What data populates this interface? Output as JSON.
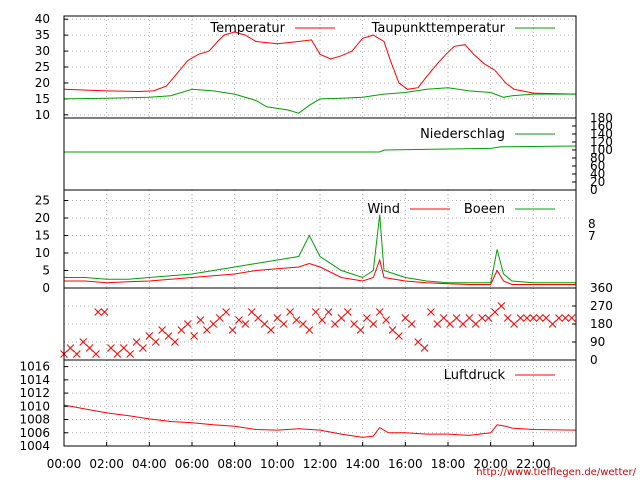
{
  "chart_data": {
    "type": "line",
    "x_tick_labels": [
      "00:00",
      "02:00",
      "04:00",
      "06:00",
      "08:00",
      "10:00",
      "12:00",
      "14:00",
      "16:00",
      "18:00",
      "20:00",
      "22:00"
    ],
    "x_range_hours": [
      0,
      24
    ],
    "credit": "http://www.tiefflegen.de/wetter/",
    "colors": {
      "red": "#ff0000",
      "green": "#00a000"
    },
    "panels": [
      {
        "id": "temperature",
        "ylim": [
          9,
          41
        ],
        "y_ticks": [
          "10",
          "15",
          "20",
          "25",
          "30",
          "35",
          "40"
        ],
        "grid": true,
        "series": [
          {
            "name": "Temperatur",
            "color": "#ff0000",
            "points": [
              [
                0,
                18
              ],
              [
                2,
                17.5
              ],
              [
                3.5,
                17.3
              ],
              [
                4.2,
                17.5
              ],
              [
                4.8,
                19
              ],
              [
                5.3,
                23
              ],
              [
                5.8,
                27
              ],
              [
                6.3,
                29
              ],
              [
                6.8,
                30
              ],
              [
                7.2,
                33
              ],
              [
                7.5,
                35
              ],
              [
                8,
                36
              ],
              [
                8.5,
                35
              ],
              [
                9,
                33
              ],
              [
                10,
                32.3
              ],
              [
                11,
                33
              ],
              [
                11.6,
                33.5
              ],
              [
                12,
                29
              ],
              [
                12.5,
                27.5
              ],
              [
                13,
                28.5
              ],
              [
                13.5,
                30
              ],
              [
                14,
                34
              ],
              [
                14.5,
                35
              ],
              [
                15,
                33
              ],
              [
                15.3,
                27
              ],
              [
                15.7,
                20
              ],
              [
                16.1,
                18
              ],
              [
                16.6,
                18.5
              ],
              [
                17,
                22
              ],
              [
                17.5,
                26
              ],
              [
                17.9,
                29
              ],
              [
                18.3,
                31.5
              ],
              [
                18.8,
                32
              ],
              [
                19.2,
                29
              ],
              [
                19.7,
                26
              ],
              [
                20.2,
                24
              ],
              [
                20.7,
                20
              ],
              [
                21.1,
                18
              ],
              [
                22,
                16.8
              ],
              [
                24,
                16.5
              ]
            ]
          },
          {
            "name": "Taupunkttemperatur",
            "color": "#00a000",
            "points": [
              [
                0,
                15
              ],
              [
                2,
                15.2
              ],
              [
                4,
                15.5
              ],
              [
                5,
                16
              ],
              [
                6,
                18
              ],
              [
                7,
                17.5
              ],
              [
                8,
                16.5
              ],
              [
                9,
                14.5
              ],
              [
                9.5,
                12.5
              ],
              [
                10,
                12
              ],
              [
                10.5,
                11.5
              ],
              [
                11,
                10.5
              ],
              [
                11.5,
                13
              ],
              [
                12,
                15
              ],
              [
                13,
                15.2
              ],
              [
                14,
                15.5
              ],
              [
                15,
                16.5
              ],
              [
                16,
                17
              ],
              [
                17,
                18
              ],
              [
                18,
                18.5
              ],
              [
                19,
                17.5
              ],
              [
                20,
                17
              ],
              [
                20.6,
                15.5
              ],
              [
                21,
                16
              ],
              [
                22,
                16.5
              ],
              [
                24,
                16.5
              ]
            ]
          }
        ]
      },
      {
        "id": "precipitation",
        "ylim": [
          0,
          180
        ],
        "y_ticks": [
          "0",
          "20",
          "40",
          "60",
          "80",
          "100",
          "120",
          "140",
          "160",
          "180"
        ],
        "grid": false,
        "series": [
          {
            "name": "Niederschlag",
            "color": "#00a000",
            "points": [
              [
                0,
                95
              ],
              [
                14.8,
                95
              ],
              [
                15,
                100
              ],
              [
                20,
                104
              ],
              [
                20.5,
                108
              ],
              [
                24,
                110
              ]
            ]
          }
        ]
      },
      {
        "id": "wind",
        "ylim": [
          0,
          28
        ],
        "y_ticks": [
          "0",
          "5",
          "10",
          "15",
          "20",
          "25"
        ],
        "right_ticks": [
          "7",
          "8"
        ],
        "grid": true,
        "series": [
          {
            "name": "Wind",
            "color": "#ff0000",
            "points": [
              [
                0,
                2
              ],
              [
                1,
                2
              ],
              [
                2,
                1.5
              ],
              [
                3,
                1.8
              ],
              [
                4,
                2
              ],
              [
                5,
                2.5
              ],
              [
                6,
                3
              ],
              [
                7,
                3.5
              ],
              [
                8,
                4
              ],
              [
                9,
                5
              ],
              [
                10,
                5.5
              ],
              [
                11,
                6
              ],
              [
                11.5,
                7
              ],
              [
                12,
                6
              ],
              [
                13,
                3
              ],
              [
                14,
                2
              ],
              [
                14.5,
                3
              ],
              [
                14.8,
                8
              ],
              [
                15,
                3
              ],
              [
                16,
                2
              ],
              [
                17,
                1.5
              ],
              [
                18,
                1.2
              ],
              [
                19,
                1
              ],
              [
                20,
                1
              ],
              [
                20.3,
                5
              ],
              [
                20.6,
                2
              ],
              [
                21,
                1
              ],
              [
                22,
                1
              ],
              [
                24,
                1
              ]
            ]
          },
          {
            "name": "Boeen",
            "color": "#00a000",
            "points": [
              [
                0,
                3
              ],
              [
                1,
                3
              ],
              [
                2,
                2.5
              ],
              [
                3,
                2.5
              ],
              [
                4,
                3
              ],
              [
                5,
                3.5
              ],
              [
                6,
                4
              ],
              [
                7,
                5
              ],
              [
                8,
                6
              ],
              [
                9,
                7
              ],
              [
                10,
                8
              ],
              [
                11,
                9
              ],
              [
                11.5,
                15
              ],
              [
                12,
                9
              ],
              [
                13,
                5
              ],
              [
                14,
                3
              ],
              [
                14.5,
                5
              ],
              [
                14.8,
                21
              ],
              [
                15,
                5
              ],
              [
                16,
                3
              ],
              [
                17,
                2
              ],
              [
                18,
                1.5
              ],
              [
                19,
                1.5
              ],
              [
                20,
                1.5
              ],
              [
                20.3,
                11
              ],
              [
                20.6,
                4
              ],
              [
                21,
                2
              ],
              [
                22,
                1.5
              ],
              [
                24,
                1.5
              ]
            ]
          }
        ]
      },
      {
        "id": "wind-direction",
        "ylim": [
          0,
          360
        ],
        "y_ticks": [
          "0",
          "90",
          "180",
          "270",
          "360"
        ],
        "grid": true,
        "markers": "x",
        "color": "#ff0000",
        "points": [
          [
            0,
            30
          ],
          [
            0.3,
            60
          ],
          [
            0.6,
            30
          ],
          [
            0.9,
            90
          ],
          [
            1.2,
            60
          ],
          [
            1.5,
            30
          ],
          [
            1.6,
            240
          ],
          [
            1.9,
            240
          ],
          [
            2.2,
            60
          ],
          [
            2.5,
            30
          ],
          [
            2.8,
            60
          ],
          [
            3.1,
            30
          ],
          [
            3.4,
            90
          ],
          [
            3.7,
            60
          ],
          [
            4,
            120
          ],
          [
            4.3,
            90
          ],
          [
            4.6,
            150
          ],
          [
            4.9,
            120
          ],
          [
            5.2,
            90
          ],
          [
            5.5,
            150
          ],
          [
            5.8,
            180
          ],
          [
            6.1,
            120
          ],
          [
            6.4,
            200
          ],
          [
            6.7,
            150
          ],
          [
            7,
            180
          ],
          [
            7.3,
            210
          ],
          [
            7.6,
            240
          ],
          [
            7.9,
            150
          ],
          [
            8.2,
            200
          ],
          [
            8.5,
            180
          ],
          [
            8.8,
            240
          ],
          [
            9.1,
            210
          ],
          [
            9.4,
            180
          ],
          [
            9.7,
            150
          ],
          [
            10,
            210
          ],
          [
            10.3,
            180
          ],
          [
            10.6,
            240
          ],
          [
            10.9,
            200
          ],
          [
            11.2,
            180
          ],
          [
            11.5,
            150
          ],
          [
            11.8,
            240
          ],
          [
            12.1,
            200
          ],
          [
            12.4,
            240
          ],
          [
            12.7,
            180
          ],
          [
            13,
            210
          ],
          [
            13.3,
            240
          ],
          [
            13.6,
            180
          ],
          [
            13.9,
            150
          ],
          [
            14.2,
            210
          ],
          [
            14.5,
            180
          ],
          [
            14.8,
            240
          ],
          [
            15.1,
            200
          ],
          [
            15.4,
            150
          ],
          [
            15.7,
            120
          ],
          [
            16,
            210
          ],
          [
            16.3,
            180
          ],
          [
            16.6,
            90
          ],
          [
            16.9,
            60
          ],
          [
            17.2,
            240
          ],
          [
            17.5,
            180
          ],
          [
            17.8,
            210
          ],
          [
            18.1,
            180
          ],
          [
            18.4,
            210
          ],
          [
            18.7,
            180
          ],
          [
            19,
            210
          ],
          [
            19.3,
            180
          ],
          [
            19.6,
            210
          ],
          [
            19.9,
            210
          ],
          [
            20.2,
            240
          ],
          [
            20.5,
            270
          ],
          [
            20.8,
            210
          ],
          [
            21.1,
            180
          ],
          [
            21.4,
            210
          ],
          [
            21.7,
            210
          ],
          [
            22,
            210
          ],
          [
            22.3,
            210
          ],
          [
            22.6,
            210
          ],
          [
            22.9,
            180
          ],
          [
            23.2,
            210
          ],
          [
            23.5,
            210
          ],
          [
            23.8,
            210
          ]
        ]
      },
      {
        "id": "pressure",
        "ylim": [
          1004,
          1017
        ],
        "y_ticks": [
          "1004",
          "1006",
          "1008",
          "1010",
          "1012",
          "1014",
          "1016"
        ],
        "grid": true,
        "series": [
          {
            "name": "Luftdruck",
            "color": "#ff0000",
            "points": [
              [
                0,
                1010.2
              ],
              [
                1,
                1009.6
              ],
              [
                2,
                1009
              ],
              [
                3,
                1008.6
              ],
              [
                4,
                1008.1
              ],
              [
                5,
                1007.7
              ],
              [
                6,
                1007.5
              ],
              [
                7,
                1007.2
              ],
              [
                8,
                1007
              ],
              [
                9,
                1006.5
              ],
              [
                10,
                1006.4
              ],
              [
                11,
                1006.6
              ],
              [
                12,
                1006.4
              ],
              [
                13,
                1005.8
              ],
              [
                14,
                1005.3
              ],
              [
                14.5,
                1005.5
              ],
              [
                14.8,
                1006.8
              ],
              [
                15.2,
                1006
              ],
              [
                16,
                1006
              ],
              [
                17,
                1005.8
              ],
              [
                18,
                1005.8
              ],
              [
                19,
                1005.6
              ],
              [
                20,
                1006
              ],
              [
                20.3,
                1007.2
              ],
              [
                20.7,
                1007
              ],
              [
                21,
                1006.7
              ],
              [
                22,
                1006.5
              ],
              [
                24,
                1006.4
              ]
            ]
          }
        ]
      }
    ]
  }
}
